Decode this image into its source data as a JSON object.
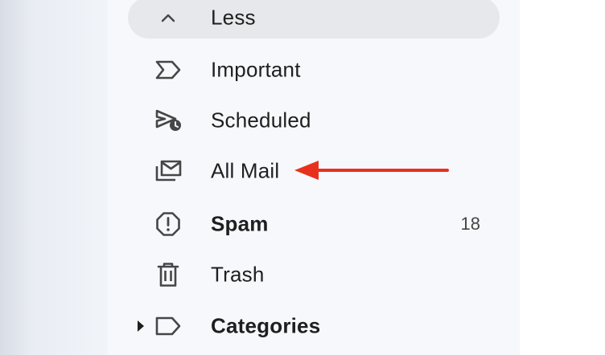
{
  "sidebar": {
    "items": [
      {
        "label": "Less",
        "icon": "chevron-up-icon"
      },
      {
        "label": "Important",
        "icon": "important-label-icon"
      },
      {
        "label": "Scheduled",
        "icon": "scheduled-send-icon"
      },
      {
        "label": "All Mail",
        "icon": "all-mail-icon"
      },
      {
        "label": "Spam",
        "icon": "spam-report-icon",
        "count": "18"
      },
      {
        "label": "Trash",
        "icon": "trash-icon"
      },
      {
        "label": "Categories",
        "icon": "label-icon"
      }
    ]
  },
  "colors": {
    "sidebar_bg": "#f6f8fc",
    "hover_bg": "#e7e8eb",
    "text": "#1f1f1f",
    "icon": "#444746",
    "annotation_arrow": "#e8311d"
  }
}
